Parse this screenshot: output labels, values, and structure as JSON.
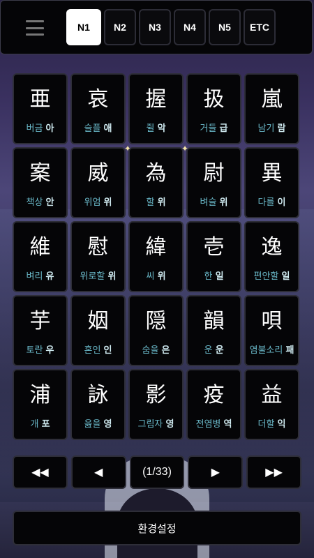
{
  "tabs": [
    "N1",
    "N2",
    "N3",
    "N4",
    "N5",
    "ETC"
  ],
  "active_tab": "N1",
  "cards": [
    {
      "kanji": "亜",
      "meaning": "버금",
      "sound": "아"
    },
    {
      "kanji": "哀",
      "meaning": "슬플",
      "sound": "애"
    },
    {
      "kanji": "握",
      "meaning": "쥘",
      "sound": "악"
    },
    {
      "kanji": "扱",
      "meaning": "거들",
      "sound": "급"
    },
    {
      "kanji": "嵐",
      "meaning": "남기",
      "sound": "람"
    },
    {
      "kanji": "案",
      "meaning": "책상",
      "sound": "안"
    },
    {
      "kanji": "威",
      "meaning": "위엄",
      "sound": "위"
    },
    {
      "kanji": "為",
      "meaning": "할",
      "sound": "위"
    },
    {
      "kanji": "尉",
      "meaning": "벼슬",
      "sound": "위"
    },
    {
      "kanji": "異",
      "meaning": "다를",
      "sound": "이"
    },
    {
      "kanji": "維",
      "meaning": "벼리",
      "sound": "유"
    },
    {
      "kanji": "慰",
      "meaning": "위로할",
      "sound": "위"
    },
    {
      "kanji": "緯",
      "meaning": "씨",
      "sound": "위"
    },
    {
      "kanji": "壱",
      "meaning": "한",
      "sound": "일"
    },
    {
      "kanji": "逸",
      "meaning": "편안할",
      "sound": "일"
    },
    {
      "kanji": "芋",
      "meaning": "토란",
      "sound": "우"
    },
    {
      "kanji": "姻",
      "meaning": "혼인",
      "sound": "인"
    },
    {
      "kanji": "隠",
      "meaning": "숨을",
      "sound": "은"
    },
    {
      "kanji": "韻",
      "meaning": "운",
      "sound": "운"
    },
    {
      "kanji": "唄",
      "meaning": "염불소리",
      "sound": "패"
    },
    {
      "kanji": "浦",
      "meaning": "개",
      "sound": "포"
    },
    {
      "kanji": "詠",
      "meaning": "읊을",
      "sound": "영"
    },
    {
      "kanji": "影",
      "meaning": "그림자",
      "sound": "영"
    },
    {
      "kanji": "疫",
      "meaning": "전염병",
      "sound": "역"
    },
    {
      "kanji": "益",
      "meaning": "더할",
      "sound": "익"
    }
  ],
  "pager": {
    "first": "◀◀",
    "prev": "◀",
    "page": "(1/33)",
    "next": "▶",
    "last": "▶▶"
  },
  "settings_label": "환경설정",
  "icons": {
    "menu": "hamburger-menu-icon"
  }
}
